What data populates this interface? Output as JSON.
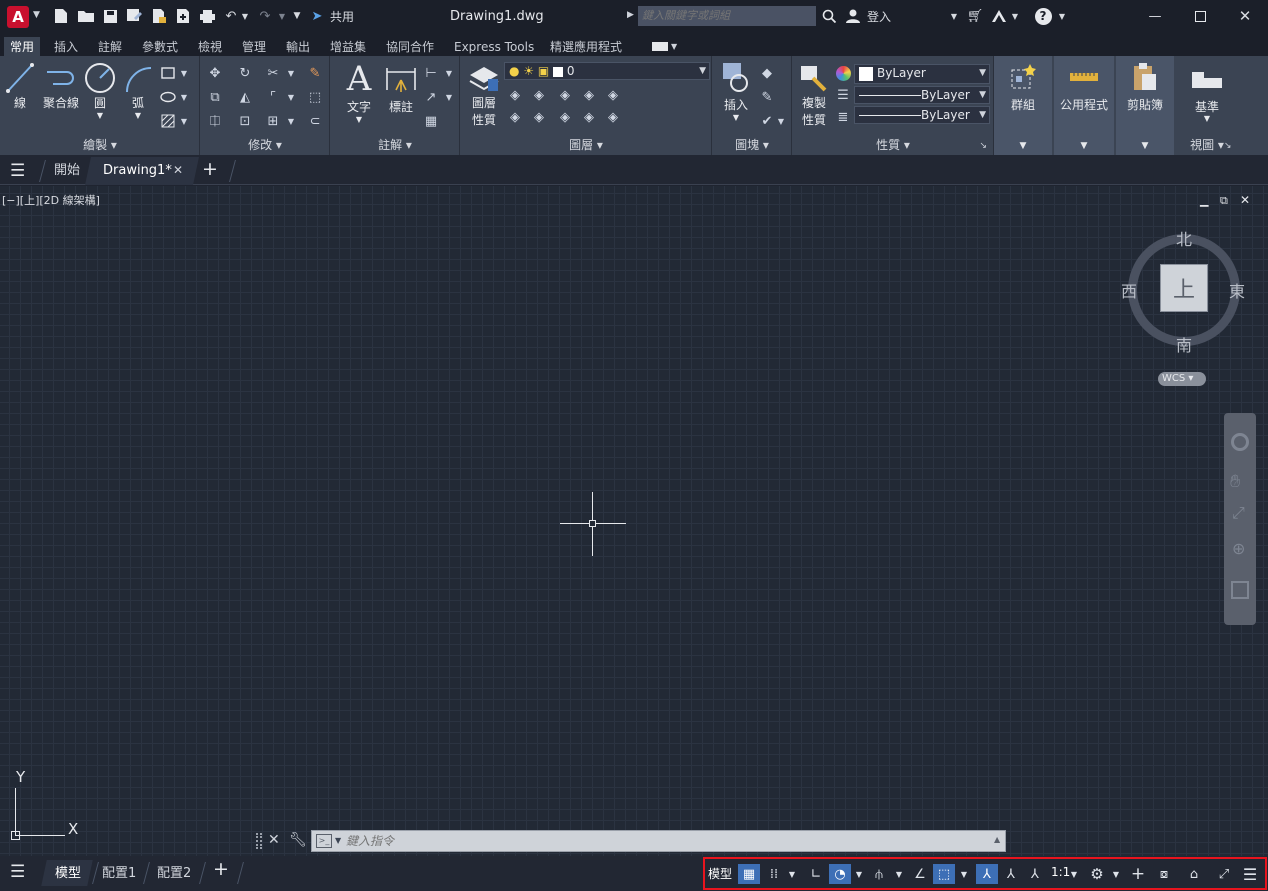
{
  "app": {
    "logo": "A",
    "filename": "Drawing1.dwg",
    "share_label": "共用",
    "search_placeholder": "鍵入關鍵字或詞組",
    "login_label": "登入"
  },
  "colors": {
    "accent": "#3d6fb6",
    "logo_red": "#c8102e",
    "status_highlight": "#e8141e"
  },
  "ribbon_tabs": [
    "常用",
    "插入",
    "註解",
    "參數式",
    "檢視",
    "管理",
    "輸出",
    "增益集",
    "協同合作",
    "Express Tools",
    "精選應用程式"
  ],
  "panels": {
    "draw": {
      "title": "繪製",
      "line": "線",
      "polyline": "聚合線",
      "circle": "圓",
      "arc": "弧"
    },
    "modify": {
      "title": "修改"
    },
    "annotation": {
      "title": "註解",
      "text": "文字",
      "dimension": "標註"
    },
    "layers": {
      "title": "圖層",
      "layer_props_1": "圖層",
      "layer_props_2": "性質",
      "current_layer": "0"
    },
    "block": {
      "title": "圖塊",
      "insert": "插入"
    },
    "properties": {
      "title": "性質",
      "match_1": "複製",
      "match_2": "性質",
      "color": "ByLayer",
      "linetype": "ByLayer",
      "lineweight": "ByLayer"
    },
    "groups": {
      "title": "群組"
    },
    "utilities": {
      "title": "公用程式"
    },
    "clipboard": {
      "title": "剪貼簿"
    },
    "view": {
      "title": "視圖",
      "base": "基準"
    }
  },
  "doc_tabs": {
    "start": "開始",
    "drawing": "Drawing1*"
  },
  "viewport": {
    "label": "[−][上][2D 線架構]"
  },
  "viewcube": {
    "north": "北",
    "south": "南",
    "east": "東",
    "west": "西",
    "face": "上",
    "wcs": "WCS"
  },
  "ucs": {
    "x": "X",
    "y": "Y"
  },
  "command": {
    "placeholder": "鍵入指令"
  },
  "layout_tabs": [
    "模型",
    "配置1",
    "配置2"
  ],
  "status": {
    "model": "模型",
    "scale": "1:1"
  }
}
